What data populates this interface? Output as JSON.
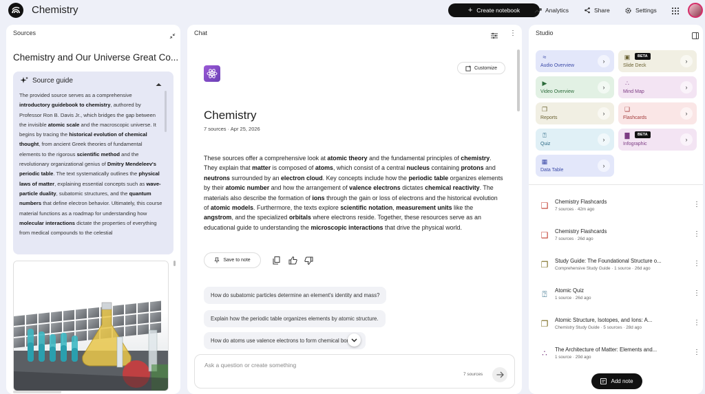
{
  "app": {
    "title": "Chemistry"
  },
  "topbar": {
    "create_label": "Create notebook",
    "analytics_label": "Analytics",
    "share_label": "Share",
    "settings_label": "Settings"
  },
  "sources": {
    "header": "Sources",
    "doc_title": "Chemistry and Our Universe Great Co...",
    "guide_title": "Source guide"
  },
  "chat": {
    "header": "Chat",
    "customize_label": "Customize",
    "title": "Chemistry",
    "meta": "7 sources · Apr 25, 2026",
    "save_label": "Save to note",
    "suggestions": [
      "How do subatomic particles determine an element's identity and mass?",
      "Explain how the periodic table organizes elements by atomic structure.",
      "How do atoms use valence electrons to form chemical bonds?"
    ],
    "input_placeholder": "Ask a question or create something",
    "source_count": "7 sources"
  },
  "studio": {
    "header": "Studio",
    "tiles": [
      {
        "label": "Audio Overview",
        "icon": "audio-wave-icon",
        "bg": "#e3e7fa",
        "fg": "#3b4aa8",
        "beta": false
      },
      {
        "label": "Slide Deck",
        "icon": "slides-icon",
        "bg": "#f1efe3",
        "fg": "#6b6233",
        "beta": true
      },
      {
        "label": "Video Overview",
        "icon": "video-icon",
        "bg": "#e2f1e4",
        "fg": "#2c6b3a",
        "beta": false
      },
      {
        "label": "Mind Map",
        "icon": "mind-map-icon",
        "bg": "#f3e4f3",
        "fg": "#7c3b83",
        "beta": false
      },
      {
        "label": "Reports",
        "icon": "report-icon",
        "bg": "#f1efe3",
        "fg": "#6b6233",
        "beta": false
      },
      {
        "label": "Flashcards",
        "icon": "flashcards-icon",
        "bg": "#fae6e6",
        "fg": "#a33a3a",
        "beta": false
      },
      {
        "label": "Quiz",
        "icon": "quiz-icon",
        "bg": "#e0f0f6",
        "fg": "#2d6a85",
        "beta": false
      },
      {
        "label": "Infographic",
        "icon": "infographic-icon",
        "bg": "#f3e4f3",
        "fg": "#7c3b83",
        "beta": true
      },
      {
        "label": "Data Table",
        "icon": "data-table-icon",
        "bg": "#e3e7fa",
        "fg": "#3b4aa8",
        "beta": false
      }
    ],
    "beta_label": "BETA",
    "notes": [
      {
        "title": "Chemistry Flashcards",
        "sub": "7 sources · 42m ago",
        "icon": "flashcards-icon",
        "color": "#c0392b"
      },
      {
        "title": "Chemistry Flashcards",
        "sub": "7 sources · 26d ago",
        "icon": "flashcards-icon",
        "color": "#c0392b"
      },
      {
        "title": "Study Guide: The Foundational Structure o...",
        "sub": "Comprehensive Study Guide · 1 source · 26d ago",
        "icon": "report-icon",
        "color": "#7a6a1f"
      },
      {
        "title": "Atomic Quiz",
        "sub": "1 source · 26d ago",
        "icon": "quiz-icon",
        "color": "#2d6a85"
      },
      {
        "title": "Atomic Structure, Isotopes, and Ions: A...",
        "sub": "Chemistry Study Guide · 5 sources · 28d ago",
        "icon": "report-icon",
        "color": "#7a6a1f"
      },
      {
        "title": "The Architecture of Matter: Elements and...",
        "sub": "1 source · 29d ago",
        "icon": "mind-map-icon",
        "color": "#7c3b83"
      }
    ],
    "add_note_label": "Add note"
  }
}
